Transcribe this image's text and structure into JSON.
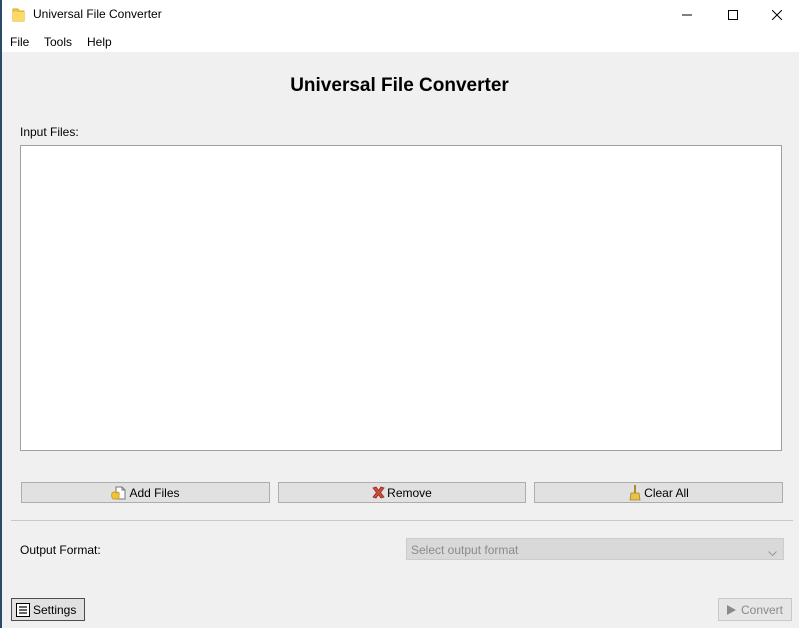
{
  "window": {
    "title": "Universal File Converter",
    "icon": "folder-icon"
  },
  "menu": {
    "items": [
      "File",
      "Tools",
      "Help"
    ]
  },
  "main": {
    "heading": "Universal File Converter",
    "input_files_label": "Input Files:",
    "file_list": [],
    "buttons": {
      "add_files": "Add Files",
      "remove": "Remove",
      "clear_all": "Clear All"
    },
    "output_format_label": "Output Format:",
    "output_format": {
      "placeholder": "Select output format",
      "selected": null
    }
  },
  "footer": {
    "settings_label": "Settings",
    "convert_label": "Convert",
    "convert_enabled": false
  },
  "colors": {
    "background": "#f0f0f0",
    "titlebar": "#ffffff",
    "button_face": "#e1e1e1",
    "disabled_text": "#8a8a8a"
  }
}
